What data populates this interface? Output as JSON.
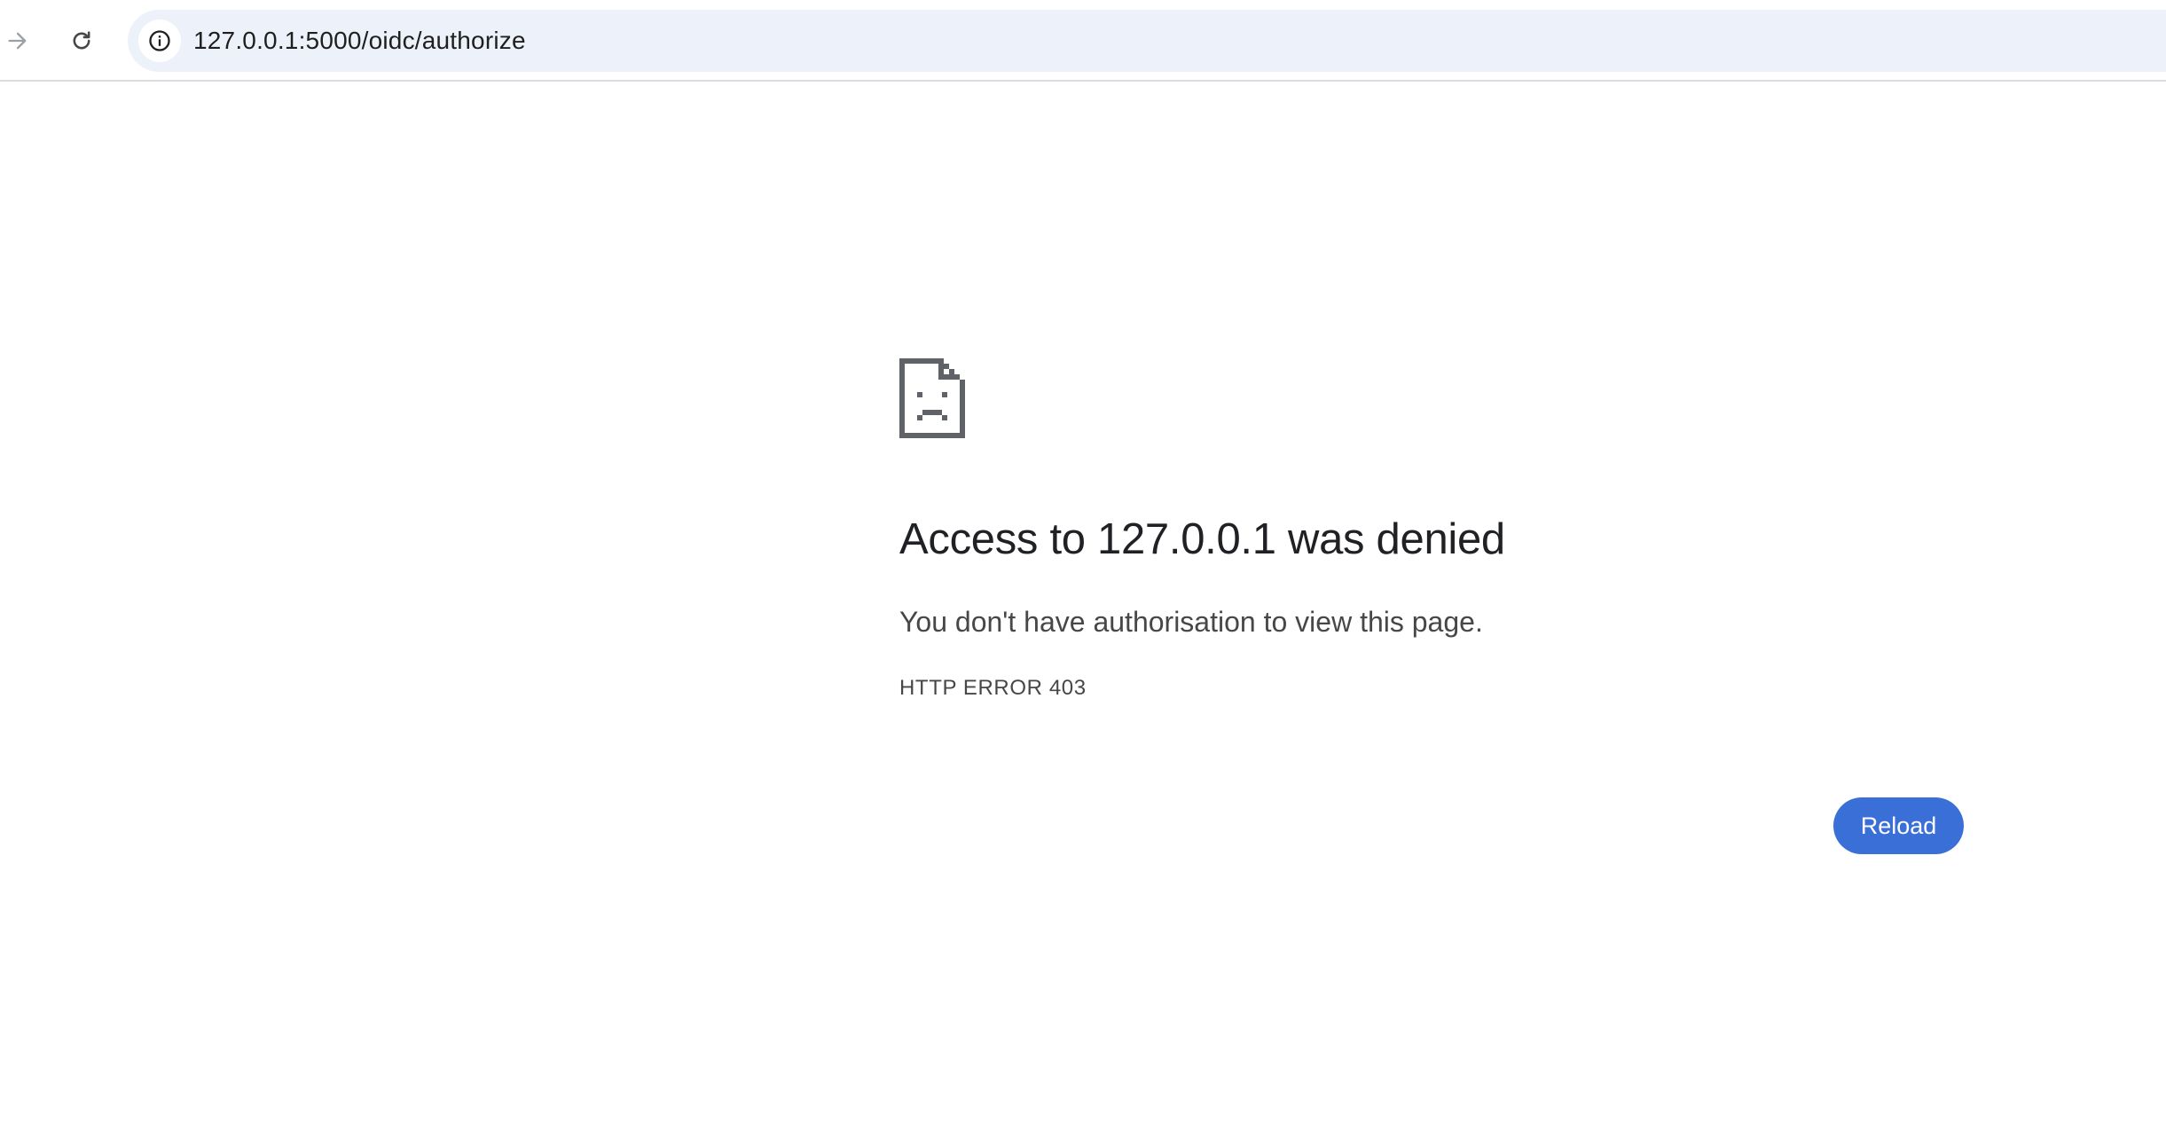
{
  "browser": {
    "forward_icon": "arrow-right-icon",
    "reload_icon": "reload-icon",
    "site_info_icon": "info-icon",
    "url": "127.0.0.1:5000/oidc/authorize"
  },
  "error_page": {
    "icon": "sad-page-icon",
    "heading": "Access to 127.0.0.1 was denied",
    "message": "You don't have authorisation to view this page.",
    "error_code": "HTTP ERROR 403",
    "reload_label": "Reload"
  },
  "colors": {
    "accent": "#3b6fd8",
    "omnibox_bg": "#edf2fa",
    "text_primary": "#202124",
    "text_secondary": "#474747"
  }
}
